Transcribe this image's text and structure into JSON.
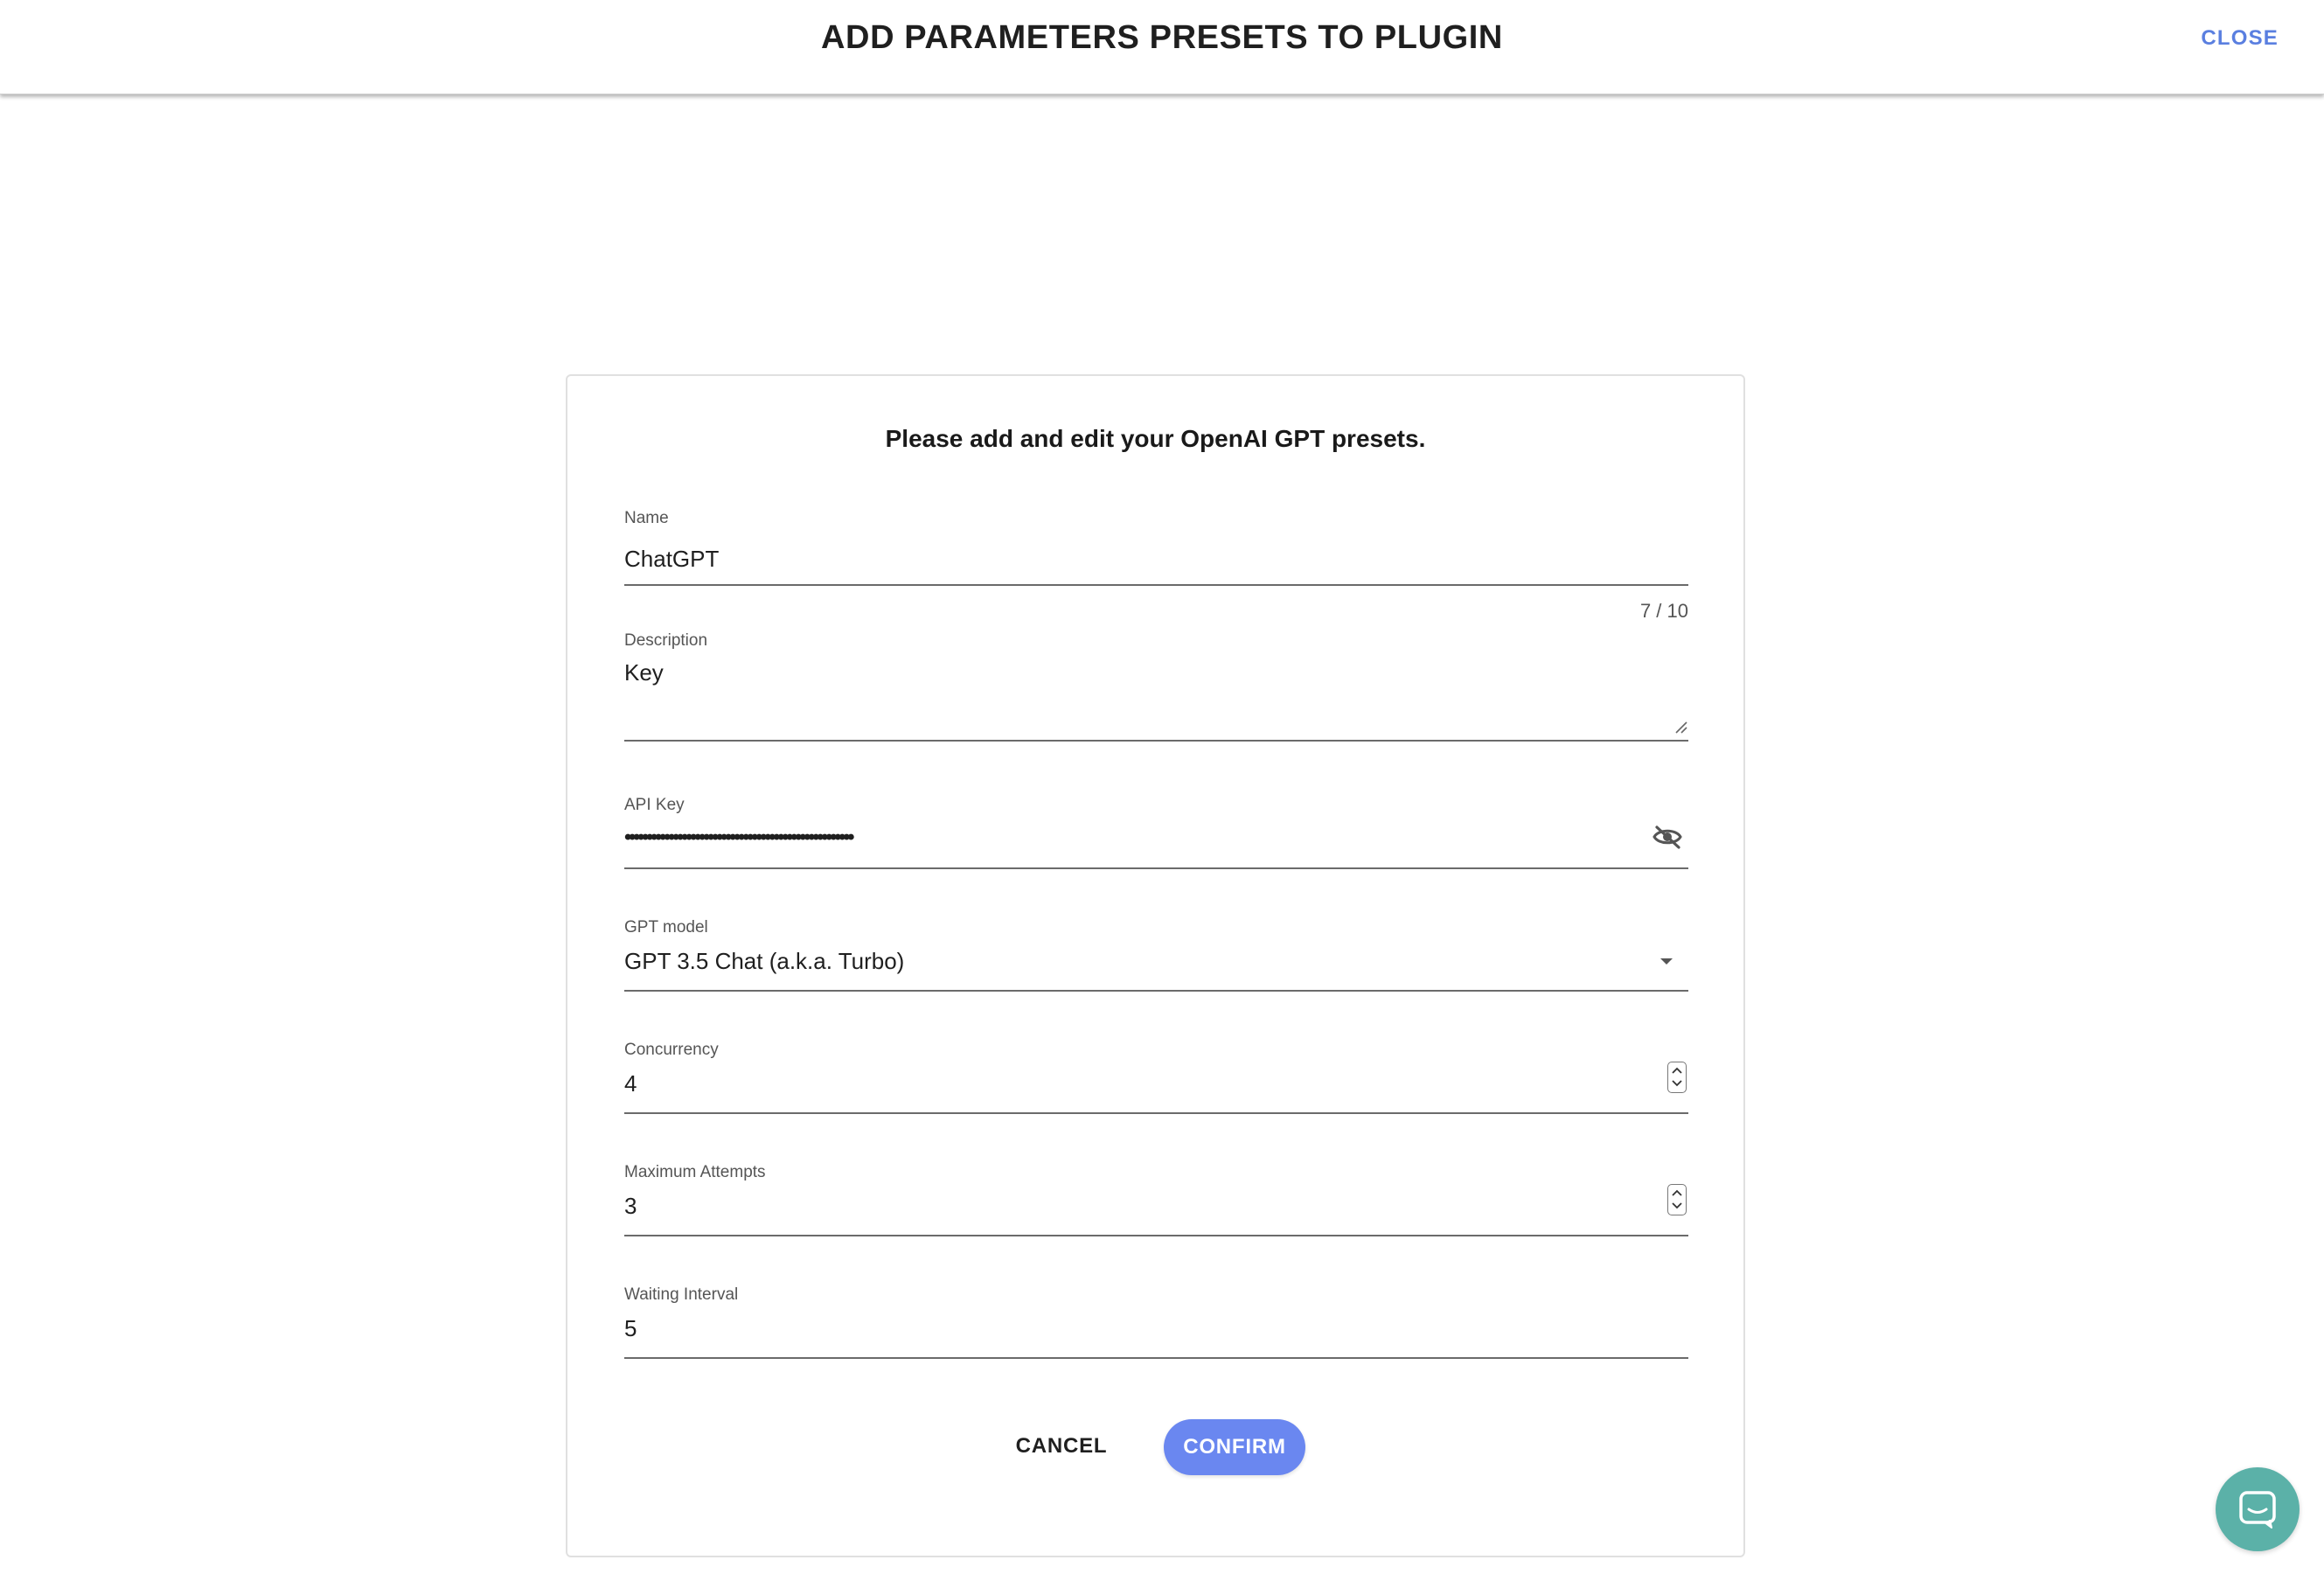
{
  "header": {
    "title": "ADD PARAMETERS PRESETS TO PLUGIN",
    "close_label": "CLOSE"
  },
  "form": {
    "heading": "Please add and edit your OpenAI GPT presets.",
    "name": {
      "label": "Name",
      "value": "ChatGPT",
      "counter": "7 / 10"
    },
    "description": {
      "label": "Description",
      "value": "Key"
    },
    "api_key": {
      "label": "API Key",
      "value": "••••••••••••••••••••••••••••••••••••••••••••••••••••",
      "visibility_icon": "eye-off-icon"
    },
    "gpt_model": {
      "label": "GPT model",
      "value": "GPT 3.5 Chat (a.k.a. Turbo)"
    },
    "concurrency": {
      "label": "Concurrency",
      "value": "4"
    },
    "max_attempts": {
      "label": "Maximum Attempts",
      "value": "3"
    },
    "waiting_interval": {
      "label": "Waiting Interval",
      "value": "5"
    }
  },
  "buttons": {
    "cancel_label": "CANCEL",
    "confirm_label": "CONFIRM"
  },
  "colors": {
    "accent": "#6a87f0",
    "close_link": "#5a7fe0",
    "chat_widget": "#5bb1a8"
  },
  "chat_widget": {
    "icon": "chat-bubble-icon"
  }
}
